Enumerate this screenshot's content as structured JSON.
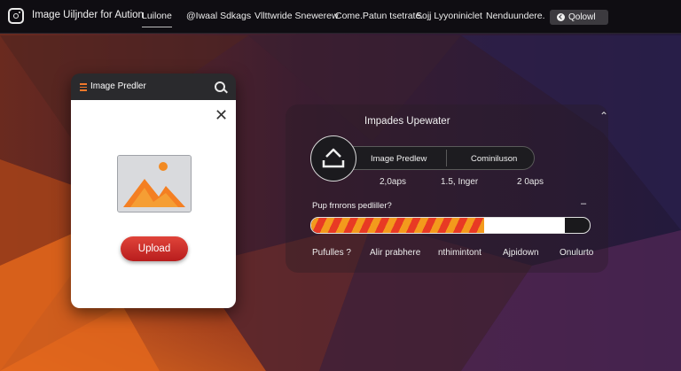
{
  "header": {
    "brand": "Image Uiljnder for Aution",
    "nav": [
      {
        "label": "Luilone",
        "active": true
      },
      {
        "label": "@Iwaal Sdkags"
      },
      {
        "label": "Vllttwride Snewerew"
      },
      {
        "label": "Come.Patun tsetrate."
      },
      {
        "label": "Sojj Lyyoniniclet"
      },
      {
        "label": "Nenduundere."
      }
    ],
    "button_label": "Qolowl"
  },
  "left_card": {
    "title": "Image Predler",
    "upload_label": "Upload"
  },
  "right_panel": {
    "title": "Impades Upewater",
    "segment_a": "Image Predlew",
    "segment_b": "Cominiluson",
    "stats": [
      "2,0aps",
      "1.5, Inger",
      "2 0aps"
    ],
    "progress_label": "Pup frnrons pedliller?",
    "progress_minus": "–",
    "progress_fraction": 0.62,
    "progress_white_fraction": 0.29,
    "footer_items": [
      "Pufulles ?",
      "Alir prabhere",
      "nthimintont",
      "Ajpidown",
      "Onulurto"
    ]
  },
  "icons": {
    "logo": "instagram-like-icon",
    "menu": "hamburger-icon",
    "search": "search-icon",
    "close": "close-icon",
    "upload": "upload-tray-icon",
    "image": "image-placeholder-icon",
    "caret": "chevron-up-icon"
  },
  "colors": {
    "accent_orange": "#f2782a",
    "upload_red": "#c8262a",
    "top_bar": "#0f0d12"
  }
}
